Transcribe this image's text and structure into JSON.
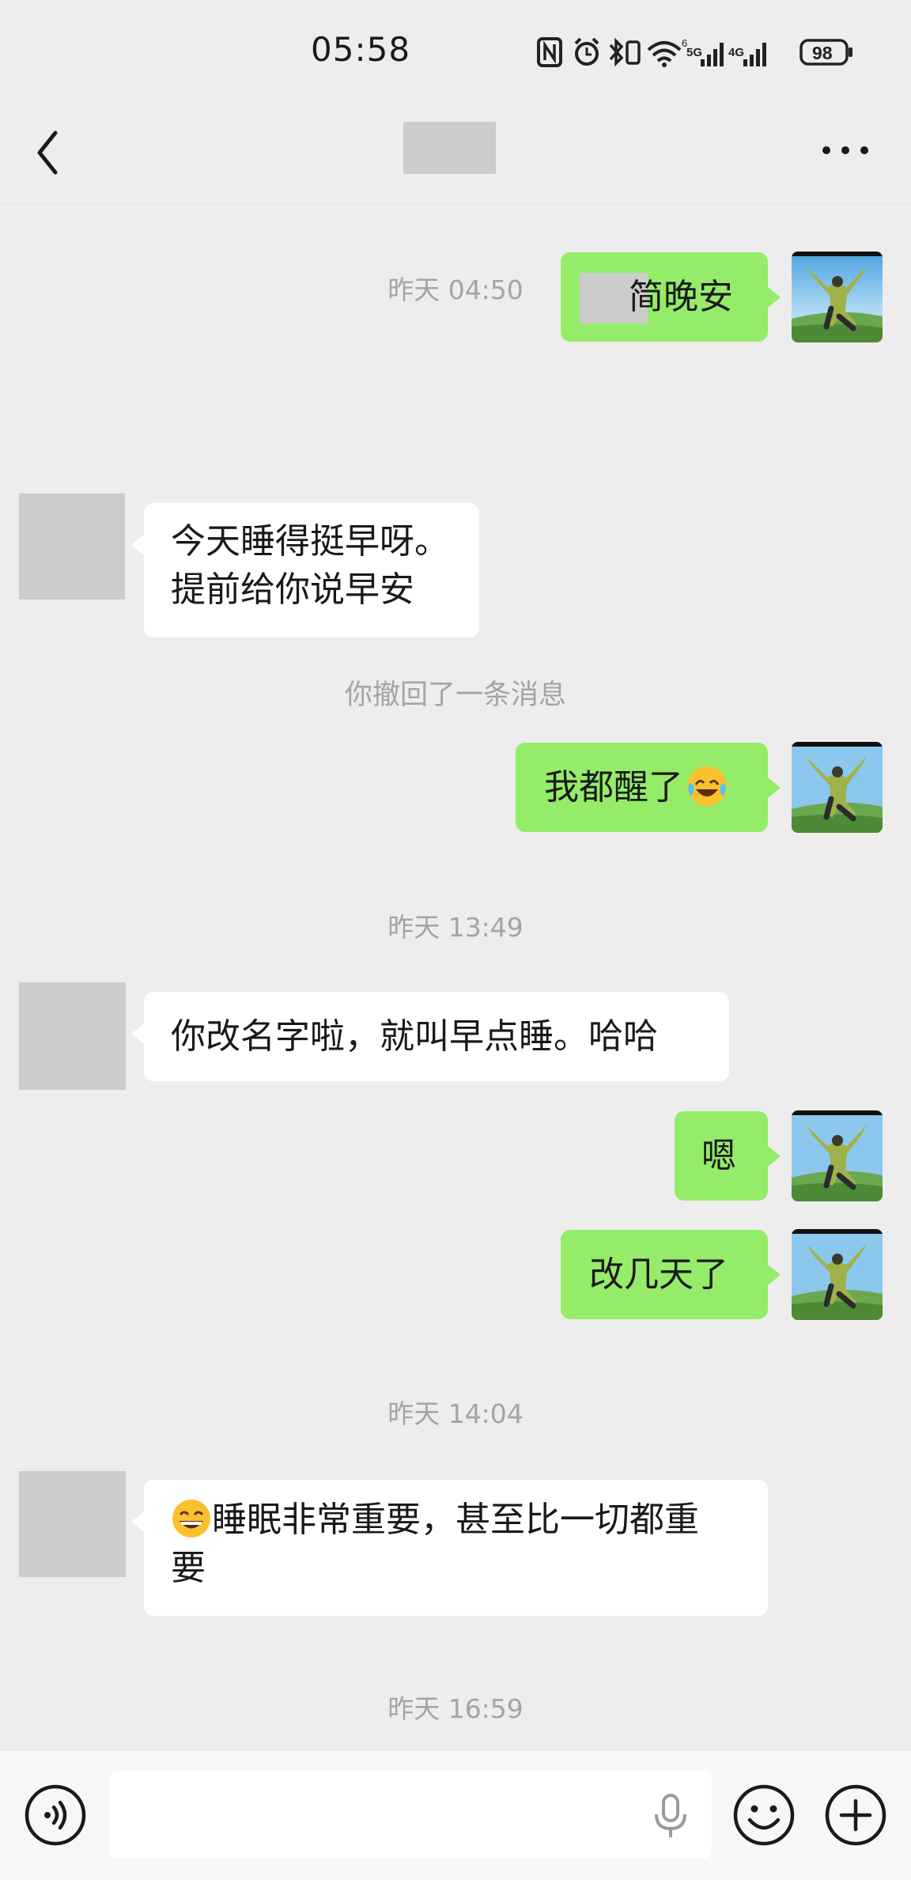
{
  "status_bar": {
    "time": "05:58",
    "wifi_badge": "6",
    "net_badge_1": "5G",
    "net_badge_2": "4G",
    "battery": "98"
  },
  "nav": {
    "back_icon": "chevron-left-icon",
    "more_icon": "more-dots-icon"
  },
  "chat": {
    "first_msg_tail": "简晚安",
    "timestamps": [
      "昨天 04:50",
      "昨天 13:49",
      "昨天 14:04",
      "昨天 16:59"
    ],
    "recall_notice": "你撤回了一条消息",
    "msg_morning_line1": "今天睡得挺早呀。",
    "msg_morning_line2": "提前给你说早安",
    "msg_awake": "我都醒了",
    "msg_name_change": "你改名字啦，就叫早点睡。哈哈",
    "msg_en": "嗯",
    "msg_days": "改几天了",
    "msg_sleep_line1": "睡眠非常重要，甚至比一切都重",
    "msg_sleep_line2": "要"
  },
  "input_bar": {
    "placeholder": "",
    "icons": [
      "voice-icon",
      "microphone-icon",
      "emoji-icon",
      "plus-icon"
    ]
  },
  "colors": {
    "background": "#ededed",
    "sent_bubble": "#95ec69",
    "received_bubble": "#ffffff",
    "placeholder_gray": "#cccccc"
  }
}
